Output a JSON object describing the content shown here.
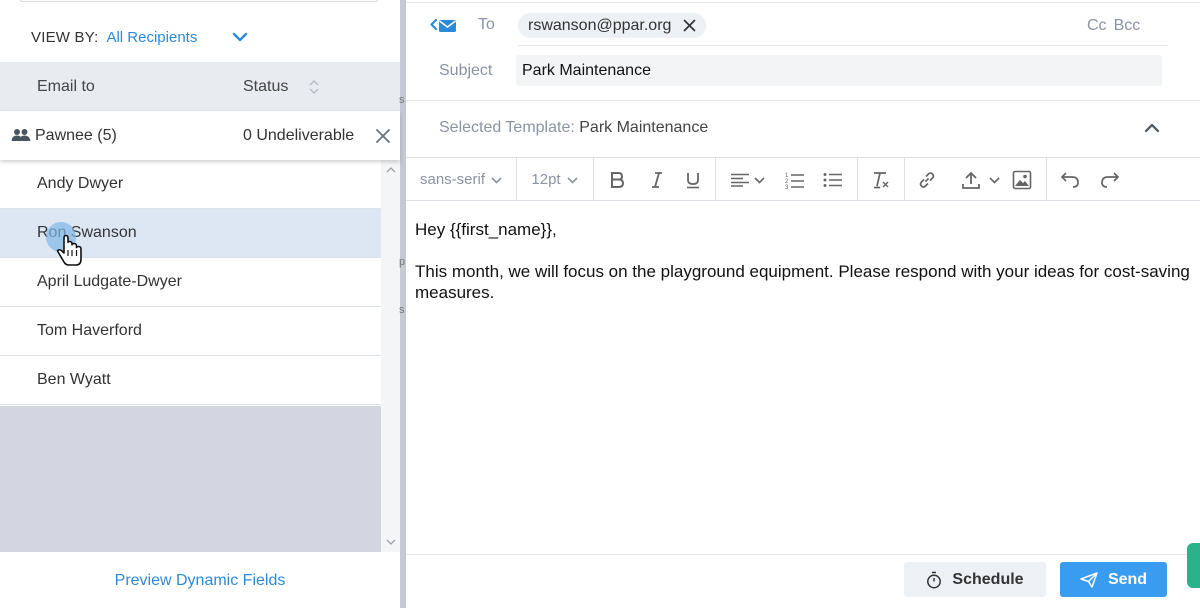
{
  "left_panel": {
    "view_by_label": "VIEW BY:",
    "view_by_value": "All Recipients",
    "columns": {
      "email_to": "Email to",
      "status": "Status"
    },
    "group": {
      "label": "Pawnee (5)",
      "status": "0 Undeliverable"
    },
    "recipients": [
      {
        "name": "Andy Dwyer",
        "selected": false
      },
      {
        "name": "Ron Swanson",
        "selected": true
      },
      {
        "name": "April Ludgate-Dwyer",
        "selected": false
      },
      {
        "name": "Tom Haverford",
        "selected": false
      },
      {
        "name": "Ben Wyatt",
        "selected": false
      }
    ],
    "preview_link": "Preview Dynamic Fields"
  },
  "compose": {
    "to_label": "To",
    "to_recipient": "rswanson@ppar.org",
    "cc_label": "Cc",
    "bcc_label": "Bcc",
    "subject_label": "Subject",
    "subject_value": "Park Maintenance",
    "template_label": "Selected Template:",
    "template_value": "Park Maintenance",
    "toolbar": {
      "font": "sans-serif",
      "size": "12pt"
    },
    "body": [
      "Hey {{first_name}},",
      "This month, we will focus on the playground equipment. Please respond with your ideas for cost-saving measures."
    ],
    "schedule_label": "Schedule",
    "send_label": "Send"
  },
  "background_glimpse": [
    "s",
    "p",
    "s"
  ],
  "colors": {
    "accent": "#2d8ad8",
    "send": "#3a9cf0",
    "selected_row": "#dde7f3",
    "header_bg": "#e8ebf0"
  },
  "icons": [
    "chevron-down-icon",
    "sort-icon",
    "group-icon",
    "close-icon",
    "scroll-up-icon",
    "scroll-down-icon",
    "hand-cursor-icon",
    "reply-email-icon",
    "chevron-up-icon",
    "bold-icon",
    "italic-icon",
    "underline-icon",
    "align-icon",
    "numbered-list-icon",
    "bullet-list-icon",
    "clear-format-icon",
    "link-icon",
    "upload-icon",
    "image-icon",
    "undo-icon",
    "redo-icon",
    "timer-icon",
    "paper-plane-icon"
  ]
}
